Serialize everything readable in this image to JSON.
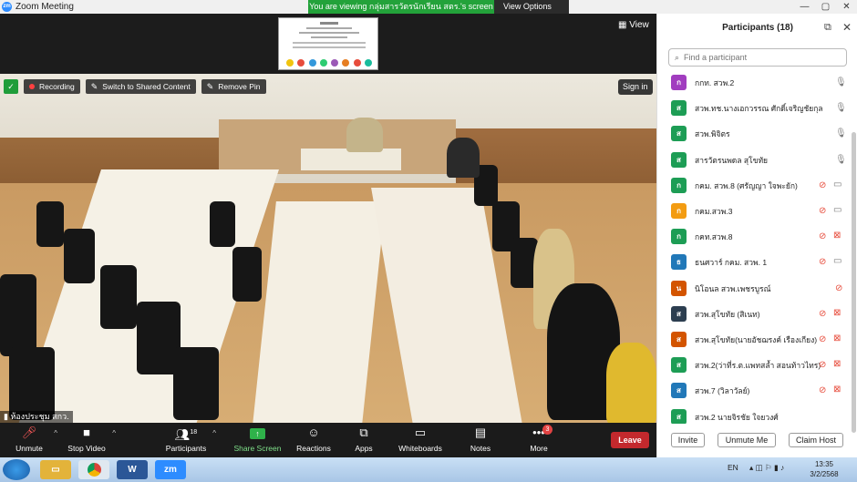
{
  "window": {
    "title": "Zoom Meeting",
    "controls": [
      "minimize-icon",
      "maximize-icon",
      "close-icon"
    ]
  },
  "share_banner": {
    "text": "You are viewing กลุ่มสารวัตรนักเรียน สตร.'s screen",
    "view_options": "View Options",
    "view_options_caret": "⌄"
  },
  "top_strip": {
    "view_label": "View"
  },
  "video": {
    "recording_label": "Recording",
    "switch_label": "Switch to Shared Content",
    "remove_pin_label": "Remove Pin",
    "sign_in_label": "Sign in",
    "speaker_name": "ห้องประชุม สกว."
  },
  "toolbar": {
    "unmute": "Unmute",
    "stop_video": "Stop Video",
    "participants": "Participants",
    "participants_count": "18",
    "share_screen": "Share Screen",
    "reactions": "Reactions",
    "apps": "Apps",
    "whiteboards": "Whiteboards",
    "notes": "Notes",
    "more": "More",
    "more_badge": "3",
    "leave": "Leave"
  },
  "participants_panel": {
    "title": "Participants (18)",
    "search_placeholder": "Find a participant",
    "participants": [
      {
        "name": "กกท. สวพ.2",
        "initial": "ก",
        "color": "#a13dbf",
        "mic": "on",
        "video": "none"
      },
      {
        "name": "สวพ.ทช.นางเอกวรรณ ศักดิ์เจริญชัยกุล",
        "initial": "ส",
        "color": "#1d9d55",
        "mic": "on",
        "video": "none"
      },
      {
        "name": "สวพ.พิจิตร",
        "initial": "ส",
        "color": "#1d9d55",
        "mic": "on",
        "video": "none"
      },
      {
        "name": "สารวัตรนพดล สุโขทัย",
        "initial": "ส",
        "color": "#1d9d55",
        "mic": "on",
        "video": "none"
      },
      {
        "name": "กคม. สวพ.8 (ศรัญญา ใจพะยัก)",
        "initial": "ก",
        "color": "#1d9d55",
        "mic": "muted",
        "video": "on"
      },
      {
        "name": "กคม.สวพ.3",
        "initial": "ก",
        "color": "#f39c12",
        "mic": "muted",
        "video": "on"
      },
      {
        "name": "กคท.สวพ.8",
        "initial": "ก",
        "color": "#1d9d55",
        "mic": "muted",
        "video": "off"
      },
      {
        "name": "ธนศวาร์ กคม. สวพ. 1",
        "initial": "ธ",
        "color": "#2178b8",
        "mic": "muted",
        "video": "on"
      },
      {
        "name": "นิโอนล สวพ.เพชรบูรณ์",
        "initial": "น",
        "color": "#d35400",
        "mic": "muted",
        "video": "none"
      },
      {
        "name": "สวพ.สุโขทัย (สิเนท)",
        "initial": "ส",
        "color": "#2c3e50",
        "mic": "muted",
        "video": "off"
      },
      {
        "name": "สวพ.สุโขทัย(นายอัชฌรงค์ เรืองเกียง)",
        "initial": "ส",
        "color": "#d35400",
        "mic": "muted",
        "video": "off"
      },
      {
        "name": "สวพ.2(ว่าที่ร.ต.แพทสล้ำ สอนท้าวไทร)",
        "initial": "ส",
        "color": "#1d9d55",
        "mic": "muted",
        "video": "off"
      },
      {
        "name": "สวพ.7 (วิลาวัลย์)",
        "initial": "ส",
        "color": "#2178b8",
        "mic": "muted",
        "video": "off"
      },
      {
        "name": "สวพ.2 นายจิรชัย ใจยวงศ์",
        "initial": "ส",
        "color": "#1d9d55",
        "mic": "none",
        "video": "none"
      }
    ],
    "invite": "Invite",
    "unmute_me": "Unmute Me",
    "claim_host": "Claim Host"
  },
  "taskbar": {
    "lang": "EN",
    "time": "13:35",
    "date": "3/2/2568",
    "apps": [
      "explorer-icon",
      "chrome-icon",
      "word-icon",
      "zoom-icon"
    ]
  }
}
